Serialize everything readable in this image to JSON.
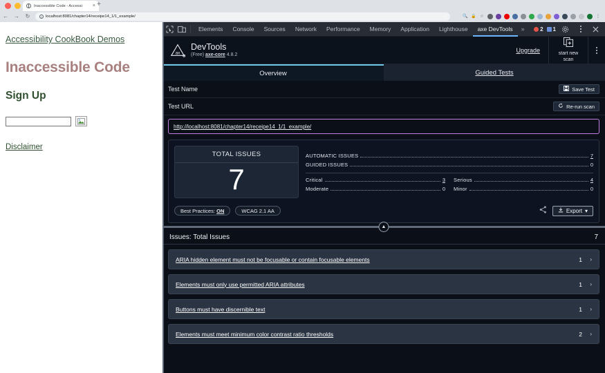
{
  "browser": {
    "tab": {
      "title": "Inaccessible Code - Accessi:",
      "close_label": "×",
      "favicon_name": "globe-icon"
    },
    "new_tab_label": "+",
    "nav": {
      "back": "←",
      "forward": "→",
      "reload": "↻"
    },
    "omnibox": {
      "url": "localhost:8081/chapter14/receipe14_1/1_example/",
      "info_glyph": "i"
    },
    "extensions": [
      "search-icon",
      "lock-icon",
      "star-icon",
      "extension-icon-1",
      "extension-icon-2",
      "extension-icon-3",
      "extension-icon-4",
      "extension-icon-5",
      "extension-icon-6",
      "extension-icon-7",
      "extension-icon-8",
      "extension-icon-9",
      "extension-icon-10",
      "extension-icon-11",
      "extension-icon-12",
      "profile-avatar",
      "browser-menu-icon"
    ]
  },
  "page": {
    "demos_link": "Accessibility CookBook Demos",
    "heading": "Inaccessible Code",
    "subheading": "Sign Up",
    "input_value": "",
    "input_placeholder": "",
    "image_button_name": "broken-image-icon",
    "disclaimer_link": "Disclaimer",
    "heading_color": "#a7807f",
    "link_color": "#2f4f2f"
  },
  "devtools": {
    "tabs": [
      "Elements",
      "Console",
      "Sources",
      "Network",
      "Performance",
      "Memory",
      "Application",
      "Lighthouse",
      "axe DevTools"
    ],
    "active_tab": "axe DevTools",
    "overflow_label": "»",
    "errors_count": "2",
    "infos_count": "1",
    "settings_icon": "gear-icon",
    "more_icon": "kebab-menu-icon",
    "close_icon": "close-icon",
    "inspect_icon": "inspect-element-icon",
    "device_icon": "device-toolbar-icon"
  },
  "axe": {
    "logo_name": "axe-logo",
    "logo_text": "ax",
    "title": "DevTools",
    "edition": "(Free)",
    "core_label": "axe-core",
    "core_version": "4.8.2",
    "upgrade_label": "Upgrade",
    "scan_button": {
      "line1": "start new",
      "line2": "scan",
      "icon": "new-scan-icon"
    },
    "kebab": "kebab-menu-icon"
  },
  "overview": {
    "tabs": [
      {
        "label": "Overview",
        "active": true
      },
      {
        "label": "Guided Tests",
        "active": false
      }
    ],
    "test_name_label": "Test Name",
    "save_test_label": "Save Test",
    "save_test_icon": "save-icon",
    "test_url_label": "Test URL",
    "rerun_label": "Re-run scan",
    "rerun_icon": "refresh-icon",
    "test_url": "http://localhost:8081/chapter14/receipe14_1/1_example/",
    "url_focus_color": "#c07fe0"
  },
  "summary": {
    "total_label": "TOTAL ISSUES",
    "total_value": "7",
    "breakdown": [
      {
        "key": "AUTOMATIC ISSUES",
        "value": "7",
        "underline": true
      },
      {
        "key": "GUIDED ISSUES",
        "value": "0",
        "underline": false
      }
    ],
    "severities": [
      {
        "key": "Critical",
        "value": "3"
      },
      {
        "key": "Serious",
        "value": "4"
      },
      {
        "key": "Moderate",
        "value": "0"
      },
      {
        "key": "Minor",
        "value": "0"
      }
    ],
    "chips": [
      {
        "label": "Best Practices:",
        "emphasis": "ON"
      },
      {
        "label": "WCAG 2.1 AA",
        "emphasis": ""
      }
    ],
    "share_icon": "share-icon",
    "export_label": "Export",
    "export_icon": "download-icon",
    "export_caret": "▾",
    "collapse_icon": "chevron-up-icon"
  },
  "issues": {
    "title": "Issues: Total Issues",
    "count": "7",
    "rows": [
      {
        "name": "ARIA hidden element must not be focusable or contain focusable elements",
        "count": "1",
        "arrow": "›"
      },
      {
        "name": "Elements must only use permitted ARIA attributes",
        "count": "1",
        "arrow": "›"
      },
      {
        "name": "Buttons must have discernible text",
        "count": "1",
        "arrow": "›"
      },
      {
        "name": "Elements must meet minimum color contrast ratio thresholds",
        "count": "2",
        "arrow": "›"
      }
    ]
  }
}
